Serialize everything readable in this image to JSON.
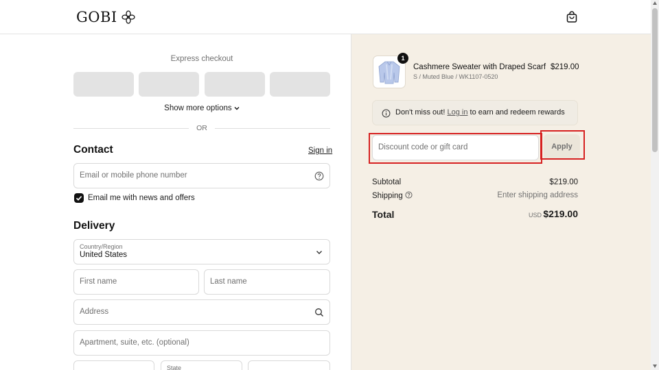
{
  "header": {
    "brand": "GOBI",
    "logo_icon": "flower-logo-icon",
    "cart_icon": "shopping-bag-icon"
  },
  "express": {
    "title": "Express checkout",
    "show_more": "Show more options",
    "divider": "OR"
  },
  "contact": {
    "heading": "Contact",
    "sign_in": "Sign in",
    "email_placeholder": "Email or mobile phone number",
    "newsletter_label": "Email me with news and offers",
    "newsletter_checked": true
  },
  "delivery": {
    "heading": "Delivery",
    "country_label": "Country/Region",
    "country_value": "United States",
    "first_name": "First name",
    "last_name": "Last name",
    "address": "Address",
    "apartment": "Apartment, suite, etc. (optional)",
    "state_label": "State"
  },
  "order": {
    "quantity": "1",
    "product_name": "Cashmere Sweater with Draped Scarf",
    "product_variant": "S / Muted Blue / WK1107-0520",
    "product_price": "$219.00"
  },
  "rewards": {
    "prefix": "Don't miss out!",
    "link": "Log in",
    "suffix": "to earn and redeem rewards"
  },
  "discount": {
    "placeholder": "Discount code or gift card",
    "apply_label": "Apply"
  },
  "summary": {
    "subtotal_label": "Subtotal",
    "subtotal_value": "$219.00",
    "shipping_label": "Shipping",
    "shipping_value": "Enter shipping address",
    "total_label": "Total",
    "currency": "USD",
    "total_value": "$219.00"
  },
  "colors": {
    "accent": "#111111",
    "sidebar_bg": "#f5efe5",
    "highlight": "#d62020"
  }
}
